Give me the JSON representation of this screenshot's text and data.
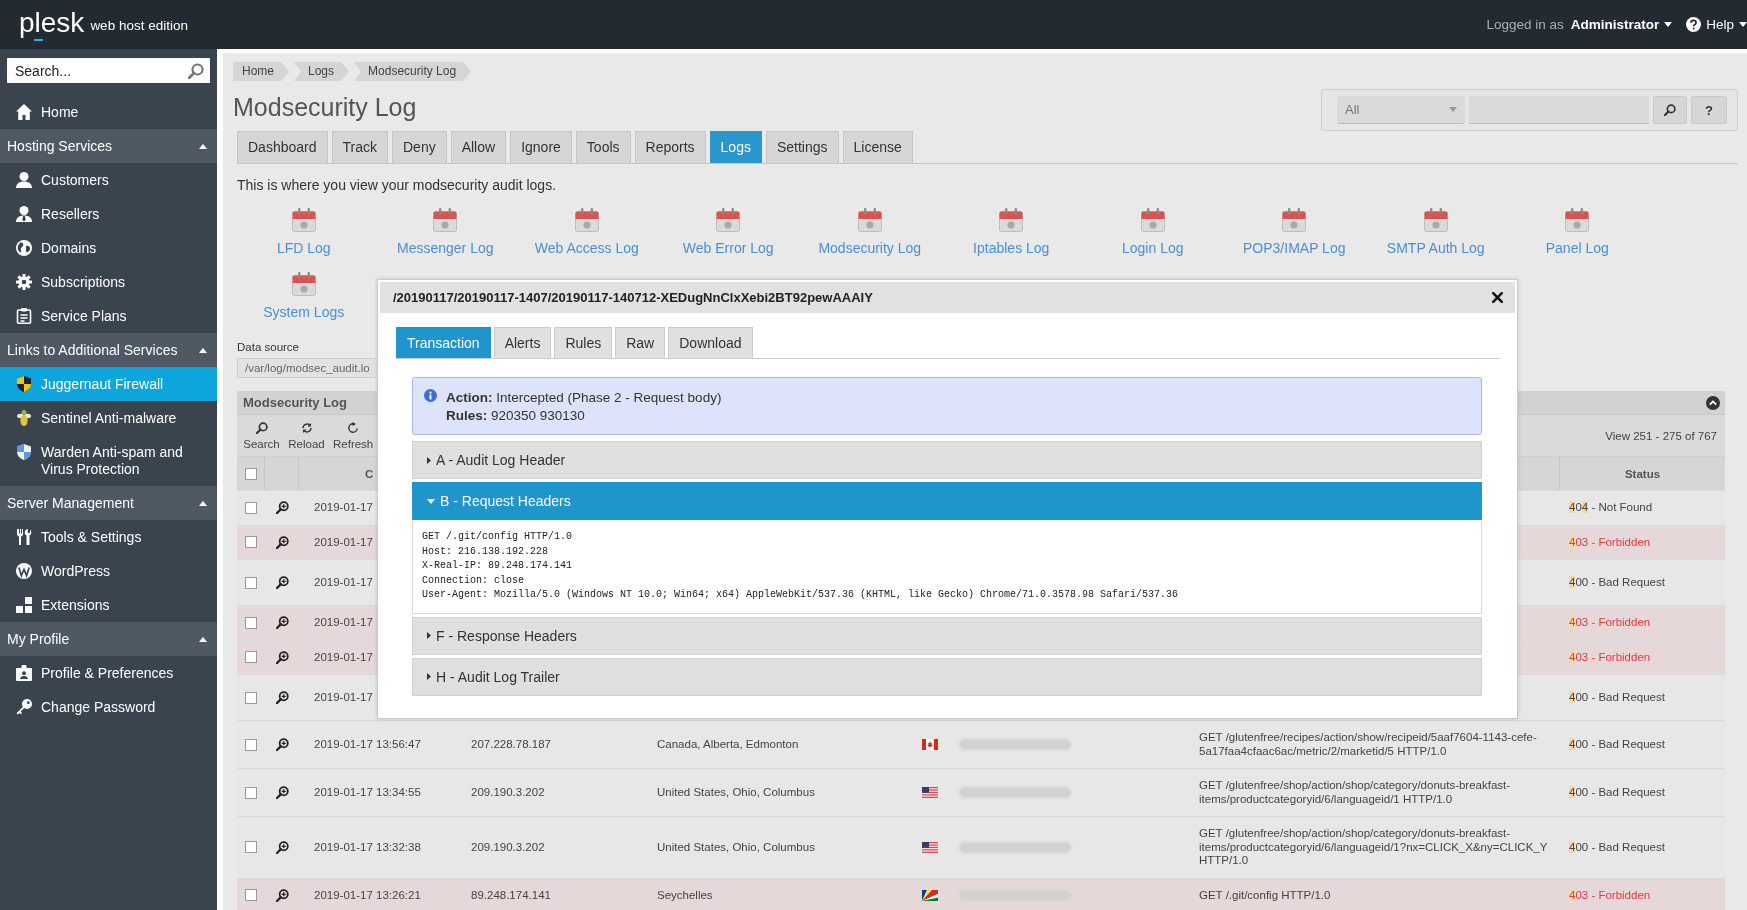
{
  "topbar": {
    "logo": "plesk",
    "edition": "web host edition",
    "login_label": "Logged in as",
    "user": "Administrator",
    "help": "Help"
  },
  "sidebar": {
    "search": {
      "placeholder": "Search..."
    },
    "sections": [
      {
        "items": [
          {
            "label": "Home",
            "selected": false
          }
        ]
      },
      {
        "title": "Hosting Services",
        "expanded": true,
        "items": [
          {
            "label": "Customers",
            "selected": false
          },
          {
            "label": "Resellers",
            "selected": false
          },
          {
            "label": "Domains",
            "selected": false
          },
          {
            "label": "Subscriptions",
            "selected": false
          },
          {
            "label": "Service Plans",
            "selected": false
          }
        ]
      },
      {
        "title": "Links to Additional Services",
        "expanded": true,
        "items": [
          {
            "label": "Juggernaut Firewall",
            "selected": true
          },
          {
            "label": "Sentinel Anti-malware",
            "selected": false
          },
          {
            "label": "Warden Anti-spam and Virus Protection",
            "selected": false
          }
        ]
      },
      {
        "title": "Server Management",
        "expanded": true,
        "items": [
          {
            "label": "Tools & Settings",
            "selected": false
          },
          {
            "label": "WordPress",
            "selected": false
          },
          {
            "label": "Extensions",
            "selected": false
          }
        ]
      },
      {
        "title": "My Profile",
        "expanded": true,
        "items": [
          {
            "label": "Profile & Preferences",
            "selected": false
          },
          {
            "label": "Change Password",
            "selected": false
          }
        ]
      }
    ]
  },
  "page": {
    "breadcrumbs": [
      "Home",
      "Logs",
      "Modsecurity Log"
    ],
    "title": "Modsecurity Log",
    "filter": {
      "value": "All"
    },
    "help_button": "?",
    "tabs": [
      {
        "label": "Dashboard",
        "selected": false
      },
      {
        "label": "Track",
        "selected": false
      },
      {
        "label": "Deny",
        "selected": false
      },
      {
        "label": "Allow",
        "selected": false
      },
      {
        "label": "Ignore",
        "selected": false
      },
      {
        "label": "Tools",
        "selected": false
      },
      {
        "label": "Reports",
        "selected": false
      },
      {
        "label": "Logs",
        "selected": true
      },
      {
        "label": "Settings",
        "selected": false
      },
      {
        "label": "License",
        "selected": false
      }
    ],
    "description": "This is where you view your modsecurity audit logs.",
    "log_links": [
      "LFD Log",
      "Messenger Log",
      "Web Access Log",
      "Web Error Log",
      "Modsecurity Log",
      "Iptables Log",
      "Login Log",
      "POP3/IMAP Log",
      "SMTP Auth Log",
      "Panel Log",
      "System Logs"
    ],
    "data_source": {
      "label": "Data source",
      "value": "/var/log/modsec_audit.lo"
    }
  },
  "log_table": {
    "title": "Modsecurity Log",
    "expanded": true,
    "toolbar": [
      "Search",
      "Reload",
      "Refresh"
    ],
    "pager": "View 251 - 275 of 767",
    "header": {
      "checked": false,
      "column_3": "C",
      "status": "Status"
    },
    "rows": [
      {
        "checked": false,
        "kind": "not_found",
        "date": "2019-01-17",
        "status": [
          {
            "text": "4",
            "highlighted": true
          },
          {
            "text": "0",
            "highlighted": false
          },
          {
            "text": "4",
            "highlighted": true
          },
          {
            "text": " - Not Found",
            "highlighted": false
          }
        ]
      },
      {
        "checked": false,
        "kind": "forbidden",
        "date": "2019-01-17",
        "status": [
          {
            "text": "4",
            "highlighted": true
          },
          {
            "text": "03 - Forbidden",
            "highlighted": false
          }
        ]
      },
      {
        "checked": false,
        "kind": "bad_request",
        "date": "2019-01-17",
        "status": [
          {
            "text": "4",
            "highlighted": true
          },
          {
            "text": "00 - Bad Request",
            "highlighted": false
          }
        ]
      },
      {
        "checked": false,
        "kind": "forbidden",
        "date": "2019-01-17",
        "status": [
          {
            "text": "4",
            "highlighted": true
          },
          {
            "text": "03 - Forbidden",
            "highlighted": false
          }
        ]
      },
      {
        "checked": false,
        "kind": "forbidden",
        "date": "2019-01-17",
        "status": [
          {
            "text": "4",
            "highlighted": true
          },
          {
            "text": "03 - Forbidden",
            "highlighted": false
          }
        ]
      },
      {
        "checked": false,
        "kind": "bad_request",
        "date": "2019-01-17",
        "status": [
          {
            "text": "4",
            "highlighted": true
          },
          {
            "text": "00 - Bad Request",
            "highlighted": false
          }
        ]
      },
      {
        "checked": false,
        "kind": "bad_request",
        "date": "2019-01-17 13:56:47",
        "ip": "207.228.78.187",
        "location": "Canada, Alberta, Edmonton",
        "request": "GET /glutenfree/recipes/action/show/recipeid/5aaf7604-1143-cefe-5a17faa4cfaac6ac/metric/2/marketid/5 HTTP/1.0",
        "status": [
          {
            "text": "4",
            "highlighted": true
          },
          {
            "text": "00 - Bad Request",
            "highlighted": false
          }
        ]
      },
      {
        "checked": false,
        "kind": "bad_request",
        "date": "2019-01-17 13:34:55",
        "ip": "209.190.3.202",
        "location": "United States, Ohio, Columbus",
        "request": "GET /glutenfree/shop/action/shop/category/donuts-breakfast-items/productcategoryid/6/languageid/1 HTTP/1.0",
        "status": [
          {
            "text": "4",
            "highlighted": true
          },
          {
            "text": "00 - Bad Request",
            "highlighted": false
          }
        ]
      },
      {
        "checked": false,
        "kind": "bad_request",
        "date": "2019-01-17 13:32:38",
        "ip": "209.190.3.202",
        "location": "United States, Ohio, Columbus",
        "request": "GET /glutenfree/shop/action/shop/category/donuts-breakfast-items/productcategoryid/6/languageid/1?nx=CLICK_X&ny=CLICK_Y HTTP/1.0",
        "status": [
          {
            "text": "4",
            "highlighted": true
          },
          {
            "text": "00 - Bad Request",
            "highlighted": false
          }
        ]
      },
      {
        "checked": false,
        "kind": "forbidden",
        "date": "2019-01-17 13:26:21",
        "ip": "89.248.174.141",
        "location": "Seychelles",
        "request": "GET /.git/config HTTP/1.0",
        "status": [
          {
            "text": "4",
            "highlighted": true
          },
          {
            "text": "03 - Forbidden",
            "highlighted": false
          }
        ]
      }
    ]
  },
  "modal": {
    "title": "/20190117/20190117-1407/20190117-140712-XEDugNnClxXebi2BT92pewAAAIY",
    "tabs": [
      {
        "label": "Transaction",
        "selected": true
      },
      {
        "label": "Alerts",
        "selected": false
      },
      {
        "label": "Rules",
        "selected": false
      },
      {
        "label": "Raw",
        "selected": false
      },
      {
        "label": "Download",
        "selected": false
      }
    ],
    "alert": [
      "**Action:** Intercepted (Phase 2 - Request body)",
      "**Rules:** 920350 930130"
    ],
    "sections": [
      {
        "title": "A - Audit Log Header",
        "expanded": false
      },
      {
        "title": "B - Request Headers",
        "expanded": true,
        "content": [
          "GET /.git/config HTTP/1.0",
          "Host: 216.138.192.228",
          "X-Real-IP: 89.248.174.141",
          "Connection: close",
          "User-Agent: Mozilla/5.0 (Windows NT 10.0; Win64; x64) AppleWebKit/537.36 (KHTML, like Gecko) Chrome/71.0.3578.98 Safari/537.36"
        ]
      },
      {
        "title": "F - Response Headers",
        "expanded": false
      },
      {
        "title": "H - Audit Log Trailer",
        "expanded": false
      }
    ]
  }
}
